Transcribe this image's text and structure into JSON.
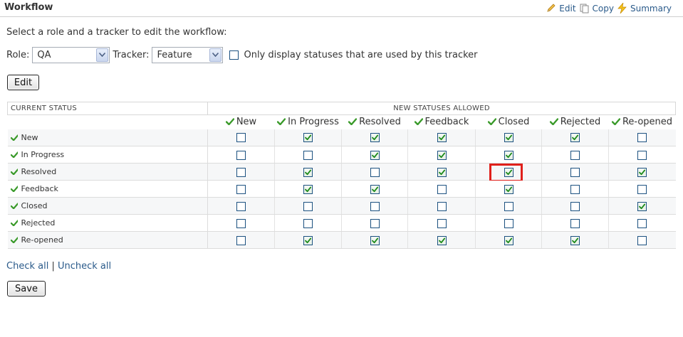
{
  "header": {
    "title": "Workflow",
    "actions": [
      {
        "label": "Edit",
        "icon": "pencil-icon"
      },
      {
        "label": "Copy",
        "icon": "copy-icon"
      },
      {
        "label": "Summary",
        "icon": "lightning-icon"
      }
    ]
  },
  "intro_text": "Select a role and a tracker to edit the workflow:",
  "filters": {
    "role_label": "Role:",
    "role_value": "QA",
    "tracker_label": "Tracker:",
    "tracker_value": "Feature",
    "only_used_label": "Only display statuses that are used by this tracker",
    "only_used_checked": false
  },
  "edit_button": "Edit",
  "table": {
    "current_status_header": "CURRENT STATUS",
    "new_statuses_header": "NEW STATUSES ALLOWED",
    "columns": [
      "New",
      "In Progress",
      "Resolved",
      "Feedback",
      "Closed",
      "Rejected",
      "Re-opened"
    ],
    "rows": [
      {
        "status": "New",
        "allowed": [
          false,
          true,
          true,
          true,
          true,
          true,
          false
        ]
      },
      {
        "status": "In Progress",
        "allowed": [
          false,
          false,
          true,
          true,
          true,
          false,
          false
        ]
      },
      {
        "status": "Resolved",
        "allowed": [
          false,
          true,
          false,
          true,
          true,
          false,
          true
        ]
      },
      {
        "status": "Feedback",
        "allowed": [
          false,
          true,
          true,
          false,
          true,
          false,
          false
        ]
      },
      {
        "status": "Closed",
        "allowed": [
          false,
          false,
          false,
          false,
          false,
          false,
          true
        ]
      },
      {
        "status": "Rejected",
        "allowed": [
          false,
          false,
          false,
          false,
          false,
          false,
          false
        ]
      },
      {
        "status": "Re-opened",
        "allowed": [
          false,
          true,
          true,
          true,
          true,
          true,
          false
        ]
      }
    ],
    "highlighted_cell": {
      "row": 2,
      "col": 4
    }
  },
  "links": {
    "check_all": "Check all",
    "separator": "|",
    "uncheck_all": "Uncheck all"
  },
  "save_button": "Save",
  "colors": {
    "link": "#2a5a8a",
    "check_green": "#3a9a2a",
    "highlight": "#e0201b"
  }
}
